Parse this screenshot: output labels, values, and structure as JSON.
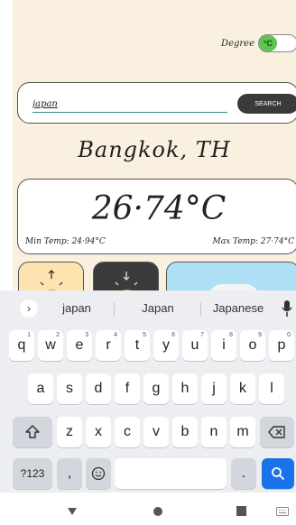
{
  "degree": {
    "label": "Degree",
    "unit_symbol": "°C"
  },
  "search": {
    "value": "japan",
    "button_label": "SEARCH"
  },
  "city": {
    "title": "Bangkok, TH"
  },
  "temperature": {
    "current": "26·74°C",
    "min_text": "Min Temp: 24·94°C",
    "max_text": "Max Temp: 27·74°C"
  },
  "keyboard": {
    "suggestions": [
      "japan",
      "Japan",
      "Japanese"
    ],
    "row1": [
      {
        "k": "q",
        "n": "1"
      },
      {
        "k": "w",
        "n": "2"
      },
      {
        "k": "e",
        "n": "3"
      },
      {
        "k": "r",
        "n": "4"
      },
      {
        "k": "t",
        "n": "5"
      },
      {
        "k": "y",
        "n": "6"
      },
      {
        "k": "u",
        "n": "7"
      },
      {
        "k": "i",
        "n": "8"
      },
      {
        "k": "o",
        "n": "9"
      },
      {
        "k": "p",
        "n": "0"
      }
    ],
    "row2": [
      "a",
      "s",
      "d",
      "f",
      "g",
      "h",
      "j",
      "k",
      "l"
    ],
    "row3": [
      "z",
      "x",
      "c",
      "v",
      "b",
      "n",
      "m"
    ],
    "symbols_label": "?123",
    "comma_label": ",",
    "period_label": "."
  },
  "colors": {
    "app_background": "#faf0e0",
    "toggle_on": "#5fc34d",
    "search_button": "#3a3a3a",
    "enter_key": "#1a73e8",
    "tile_sun": "#fde3b0",
    "tile_dark": "#3b3b3b",
    "tile_sky": "#aee0f6"
  }
}
